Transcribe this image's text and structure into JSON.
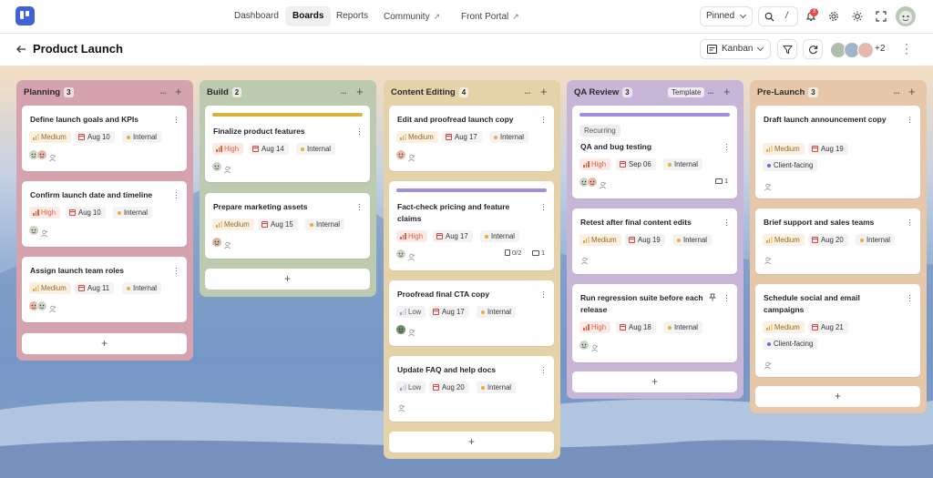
{
  "nav": {
    "items": [
      "Dashboard",
      "Boards",
      "Reports",
      "Community",
      "Front Portal"
    ],
    "active": "Boards",
    "pinned": "Pinned",
    "notifications": "3",
    "search_shortcut": "/"
  },
  "header": {
    "title": "Product Launch",
    "view": "Kanban",
    "extra_members": "+2"
  },
  "colors": {
    "high": "#e5623f",
    "medium": "#e0a23b",
    "low": "#9aa0ab",
    "internal": "#f0a93a",
    "client": "#5b6ee1",
    "planning": "#d5a3ad",
    "build": "#bccab0",
    "content": "#e6d2a8",
    "qa": "#c8b6d8",
    "prelaunch": "#e6c7aa"
  },
  "add_symbol": "+",
  "columns": [
    {
      "name": "Planning",
      "count": "3",
      "cards": [
        {
          "title": "Define launch goals and KPIs",
          "priority": "Medium",
          "date": "Aug 10",
          "tag": "Internal"
        },
        {
          "title": "Confirm launch date and timeline",
          "priority": "High",
          "date": "Aug 10",
          "tag": "Internal"
        },
        {
          "title": "Assign launch team roles",
          "priority": "Medium",
          "date": "Aug 11",
          "tag": "Internal"
        }
      ]
    },
    {
      "name": "Build",
      "count": "2",
      "cards": [
        {
          "title": "Finalize product features",
          "priority": "High",
          "date": "Aug 14",
          "tag": "Internal"
        },
        {
          "title": "Prepare marketing assets",
          "priority": "Medium",
          "date": "Aug 15",
          "tag": "Internal"
        }
      ]
    },
    {
      "name": "Content Editing",
      "count": "4",
      "cards": [
        {
          "title": "Edit and proofread launch copy",
          "priority": "Medium",
          "date": "Aug 17",
          "tag": "Internal"
        },
        {
          "title": "Fact-check pricing and feature claims",
          "priority": "High",
          "date": "Aug 17",
          "tag": "Internal",
          "checklist": "0/2",
          "comments": "1"
        },
        {
          "title": "Proofread final CTA copy",
          "priority": "Low",
          "date": "Aug 17",
          "tag": "Internal"
        },
        {
          "title": "Update FAQ and help docs",
          "priority": "Low",
          "date": "Aug 20",
          "tag": "Internal"
        }
      ]
    },
    {
      "name": "QA Review",
      "count": "3",
      "template": "Template",
      "cards": [
        {
          "title": "QA and bug testing",
          "recurring": "Recurring",
          "priority": "High",
          "date": "Sep 06",
          "tag": "Internal",
          "comments": "1"
        },
        {
          "title": "Retest after final content edits",
          "priority": "Medium",
          "date": "Aug 19",
          "tag": "Internal"
        },
        {
          "title": "Run regression suite before each release",
          "priority": "High",
          "date": "Aug 18",
          "tag": "Internal"
        }
      ]
    },
    {
      "name": "Pre-Launch",
      "count": "3",
      "cards": [
        {
          "title": "Draft launch announcement copy",
          "priority": "Medium",
          "date": "Aug 19",
          "tag": "Client-facing"
        },
        {
          "title": "Brief support and sales teams",
          "priority": "Medium",
          "date": "Aug 20",
          "tag": "Internal"
        },
        {
          "title": "Schedule social and email campaigns",
          "priority": "Medium",
          "date": "Aug 21",
          "tag": "Client-facing"
        }
      ]
    }
  ]
}
